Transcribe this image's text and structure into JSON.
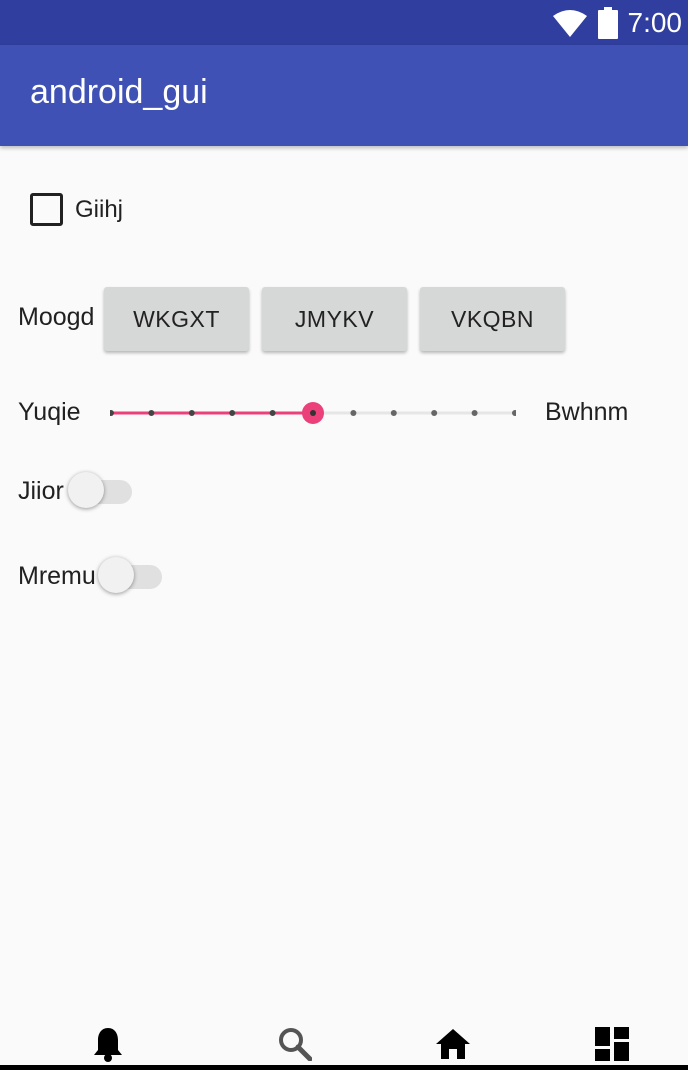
{
  "status_bar": {
    "time": "7:00",
    "wifi_icon": "wifi-icon",
    "battery_icon": "battery-icon"
  },
  "app_bar": {
    "title": "android_gui"
  },
  "checkbox": {
    "label": "Giihj",
    "checked": false
  },
  "button_row": {
    "label": "Moogd",
    "buttons": [
      "WKGXT",
      "JMYKV",
      "VKQBN"
    ]
  },
  "seekbar": {
    "start_label": "Yuqie",
    "end_label": "Bwhnm",
    "steps": 10,
    "value": 5,
    "accent_color": "#ec407a"
  },
  "switches": [
    {
      "label": "Jiior",
      "on": false
    },
    {
      "label": "Mremu",
      "on": false
    }
  ],
  "bottom_nav": [
    "bell-icon",
    "search-icon",
    "home-icon",
    "dashboard-icon"
  ]
}
